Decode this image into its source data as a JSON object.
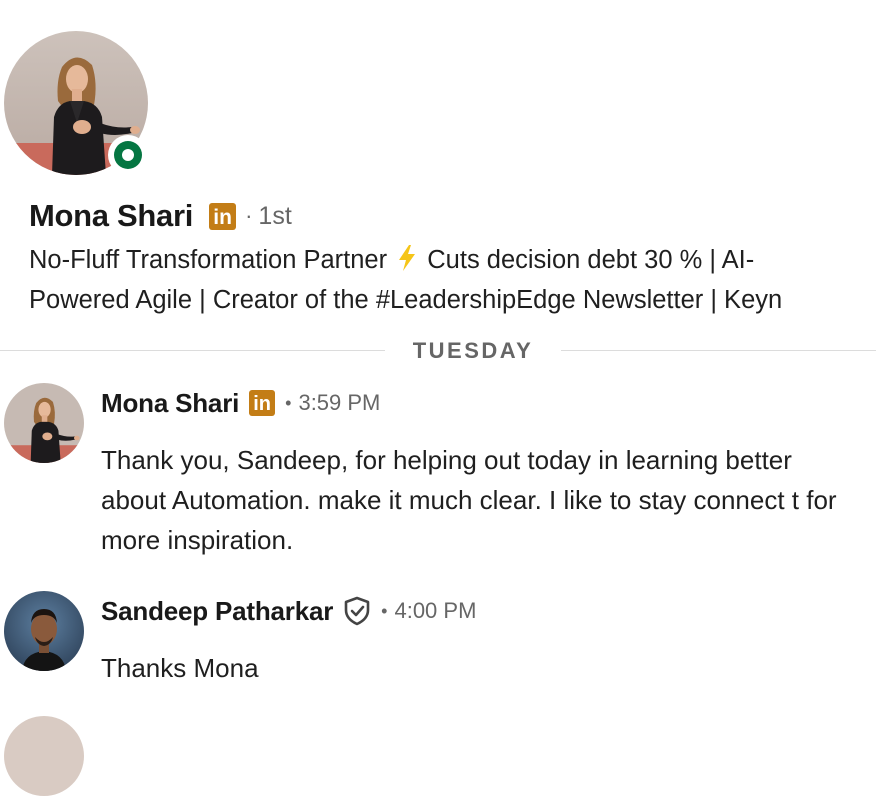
{
  "profile": {
    "name": "Mona Shari",
    "badge_text": "in",
    "separator": "·",
    "degree": "1st",
    "headline_line1_before": "No-Fluff Transformation Partner ",
    "headline_line1_after": " Cuts decision debt 30 % | AI-",
    "headline_line2": "Powered Agile | Creator of the #LeadershipEdge Newsletter | Keyn",
    "status": "online",
    "avatar_icon": "profile-photo",
    "status_color": "#057642"
  },
  "divider": {
    "label": "TUESDAY"
  },
  "messages": [
    {
      "sender": "Mona Shari",
      "badge_text": "in",
      "separator": "•",
      "time": "3:59 PM",
      "text": "Thank you, Sandeep, for helping out today in learning better about Automation. make it much clear. I like to stay connect t for more inspiration.",
      "avatar_icon": "profile-photo"
    },
    {
      "sender": "Sandeep Patharkar",
      "verified_icon": "verified-shield-icon",
      "separator": "•",
      "time": "4:00 PM",
      "text": "Thanks Mona",
      "avatar_icon": "profile-photo"
    }
  ],
  "colors": {
    "premium_badge": "#c37d16",
    "online_green": "#057642",
    "muted_text": "#666666",
    "body_text": "#1f1f1f",
    "bolt": "#f5c518"
  }
}
